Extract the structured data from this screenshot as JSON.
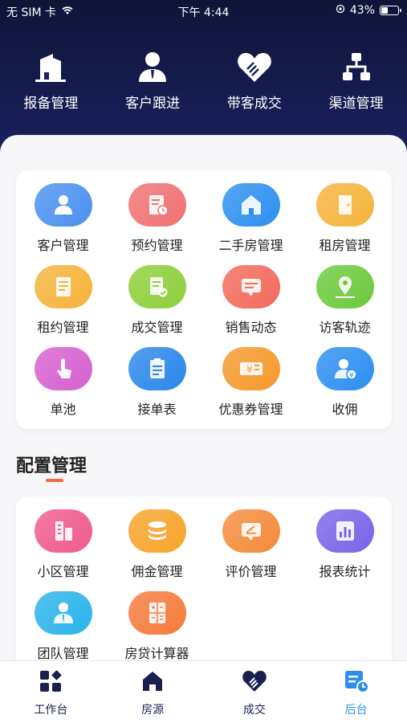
{
  "status_bar": {
    "carrier": "无 SIM 卡",
    "time": "下午 4:44",
    "battery_text": "43%",
    "battery_level": 0.43
  },
  "top_nav": [
    {
      "label": "报备管理",
      "icon": "building-icon"
    },
    {
      "label": "客户跟进",
      "icon": "person-icon"
    },
    {
      "label": "带客成交",
      "icon": "handshake-heart-icon"
    },
    {
      "label": "渠道管理",
      "icon": "hierarchy-icon"
    }
  ],
  "main_grid": [
    {
      "label": "客户管理",
      "icon": "customer-icon",
      "color": "#4a90f0"
    },
    {
      "label": "预约管理",
      "icon": "appointment-icon",
      "color": "#f07070"
    },
    {
      "label": "二手房管理",
      "icon": "house-icon",
      "color": "#2c8ff0"
    },
    {
      "label": "租房管理",
      "icon": "door-icon",
      "color": "#f5b23a"
    },
    {
      "label": "租约管理",
      "icon": "lease-icon",
      "color": "#f5b23a"
    },
    {
      "label": "成交管理",
      "icon": "deal-doc-icon",
      "color": "#8ccf3a"
    },
    {
      "label": "销售动态",
      "icon": "message-icon",
      "color": "#f26a5a"
    },
    {
      "label": "访客轨迹",
      "icon": "location-icon",
      "color": "#6cc93a"
    },
    {
      "label": "单池",
      "icon": "tap-icon",
      "color": "#d560d0"
    },
    {
      "label": "接单表",
      "icon": "clipboard-icon",
      "color": "#2a86ea"
    },
    {
      "label": "优惠券管理",
      "icon": "coupon-icon",
      "color": "#f5982a"
    },
    {
      "label": "收佣",
      "icon": "commission-icon",
      "color": "#2c8ff0"
    }
  ],
  "section": {
    "title": "配置管理"
  },
  "config_grid": [
    {
      "label": "小区管理",
      "icon": "community-icon",
      "color": "#ef5a8c"
    },
    {
      "label": "佣金管理",
      "icon": "coins-icon",
      "color": "#f7a32a"
    },
    {
      "label": "评价管理",
      "icon": "review-icon",
      "color": "#f58a3a"
    },
    {
      "label": "报表统计",
      "icon": "report-icon",
      "color": "#7a63e8"
    },
    {
      "label": "团队管理",
      "icon": "team-icon",
      "color": "#28b3ea"
    },
    {
      "label": "房贷计算器",
      "icon": "calculator-icon",
      "color": "#f57a3a"
    }
  ],
  "tabbar": [
    {
      "label": "工作台",
      "icon": "dashboard-icon",
      "active": false
    },
    {
      "label": "房源",
      "icon": "home-icon",
      "active": false
    },
    {
      "label": "成交",
      "icon": "handshake-icon",
      "active": false
    },
    {
      "label": "后台",
      "icon": "backend-icon",
      "active": true
    }
  ],
  "colors": {
    "header_dark": "#0f1438",
    "accent": "#2c8ff0",
    "section_underline": "#f26b3a"
  }
}
